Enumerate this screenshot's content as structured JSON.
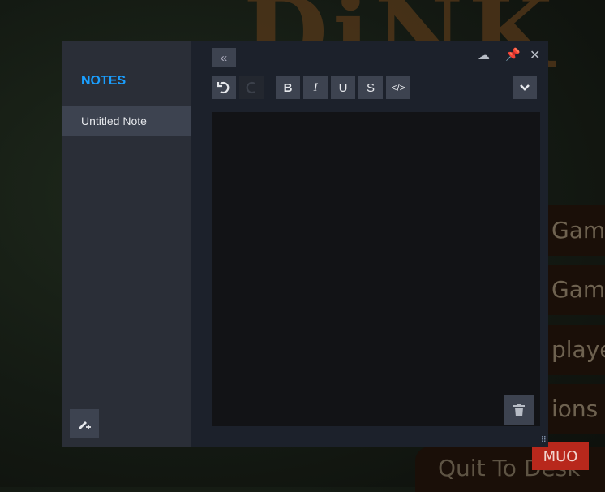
{
  "background": {
    "logo": "DiNK",
    "menu_items": [
      "Gam",
      "Gam",
      "playe",
      "ions"
    ],
    "quit": "Quit To Desk",
    "watermark": "MUO"
  },
  "sidebar": {
    "title": "NOTES",
    "notes": [
      {
        "label": "Untitled Note"
      }
    ],
    "new_note_icon": "pencil-plus-icon"
  },
  "toolbar": {
    "collapse": "«",
    "bold": "B",
    "italic": "I",
    "underline": "U",
    "strike": "S",
    "code": "</>",
    "undo_enabled": true,
    "redo_enabled": false
  },
  "window_controls": {
    "upload": "cloud-upload-icon",
    "pin": "pin-icon",
    "close": "✕"
  },
  "editor": {
    "content": ""
  },
  "colors": {
    "accent": "#1a9fff",
    "panel": "#1c212b",
    "sidebar": "#2a2e37"
  }
}
